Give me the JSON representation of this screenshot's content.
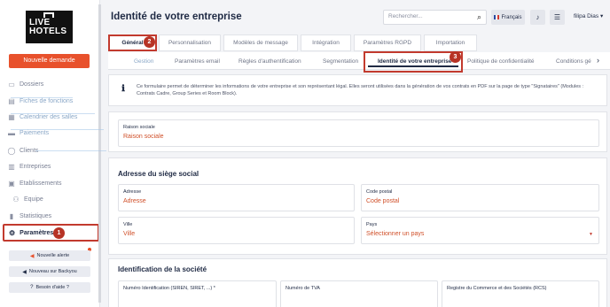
{
  "sidebar": {
    "logo_line1": "LIVE",
    "logo_line2": "HOTELS",
    "new_request": "Nouvelle demande",
    "items": [
      {
        "label": "Dossiers",
        "icon": "folder-icon"
      },
      {
        "label": "Fiches de fonctions",
        "icon": "document-icon"
      },
      {
        "label": "Calendrier des salles",
        "icon": "calendar-icon"
      },
      {
        "label": "Paiements",
        "icon": "card-icon"
      },
      {
        "label": "Clients",
        "icon": "user-icon"
      },
      {
        "label": "Entreprises",
        "icon": "briefcase-icon"
      },
      {
        "label": "Etablissements",
        "icon": "building-icon"
      },
      {
        "label": "Equipe",
        "icon": "team-icon"
      },
      {
        "label": "Statistiques",
        "icon": "chart-icon"
      }
    ],
    "settings": "Paramètres",
    "buttons": {
      "new_alert": "Nouvelle alerte",
      "backyou": "Nouveau sur Backyou",
      "help": "Besoin d'aide ?"
    }
  },
  "badges": {
    "one": "1",
    "two": "2",
    "three": "3"
  },
  "header": {
    "title": "Identité de votre entreprise",
    "search_placeholder": "Rechercher...",
    "language": "Français",
    "user": "filipa Dias"
  },
  "tabs_primary": [
    "Général",
    "Personnalisation",
    "Modèles de message",
    "Intégration",
    "Paramètres RGPD",
    "Importation"
  ],
  "tabs_secondary": [
    "Gestion",
    "Paramètres email",
    "Règles d'authentification",
    "Segmentation",
    "Identité de votre entreprise",
    "Politique de confidentialité",
    "Conditions gé"
  ],
  "info_text": "Ce formulaire permet de déterminer les informations de votre entreprise et son représentant légal. Elles seront utilisées dans la génération de vos contrats en PDF sur la page de type \"Signataires\" (Modules : Contrats Cadre, Group Series et Room Block).",
  "company": {
    "raison_label": "Raison sociale",
    "raison_value": "Raison sociale"
  },
  "address": {
    "section_title": "Adresse du siège social",
    "adresse_label": "Adresse",
    "adresse_value": "Adresse",
    "cp_label": "Code postal",
    "cp_value": "Code postal",
    "ville_label": "Ville",
    "ville_value": "Ville",
    "pays_label": "Pays",
    "pays_value": "Sélectionner un pays"
  },
  "identification": {
    "section_title": "Identification de la société",
    "siren_label": "Numéro Identification (SIREN, SIRET, ...) *",
    "tva_label": "Numéro de TVA",
    "rcs_label": "Registre du Commerce et des Sociétés (RCS)"
  },
  "colors": {
    "accent": "#e8512c",
    "annotation": "#c23a2e",
    "navy": "#1f2a44"
  }
}
